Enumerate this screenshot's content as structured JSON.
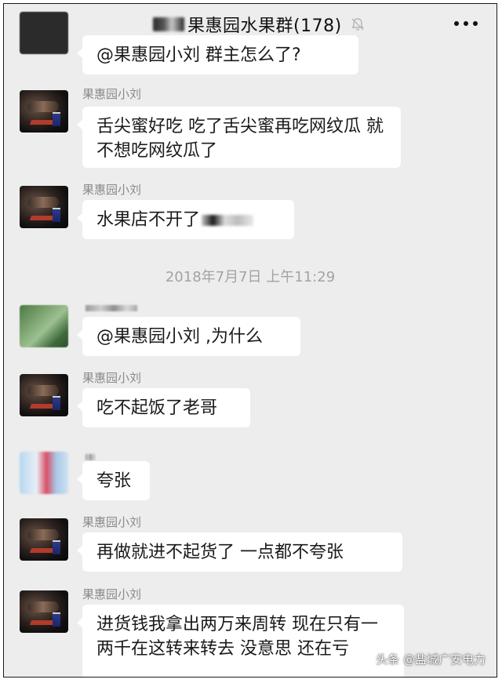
{
  "header": {
    "title": "果惠园水果群(178)",
    "back_icon": "chevron-left-icon",
    "mute_icon": "bell-muted-icon",
    "more_icon": "more-dots-icon"
  },
  "messages": [
    {
      "text": "@果惠园小刘 群主怎么了?"
    },
    {
      "sender": "果惠园小刘",
      "text": "舌尖蜜好吃 吃了舌尖蜜再吃网纹瓜 就不想吃网纹瓜了"
    },
    {
      "sender": "果惠园小刘",
      "text": "水果店不开了"
    },
    {
      "text": "@果惠园小刘 ,为什么"
    },
    {
      "sender": "果惠园小刘",
      "text": "吃不起饭了老哥"
    },
    {
      "text": "夸张"
    },
    {
      "sender": "果惠园小刘",
      "text": "再做就进不起货了 一点都不夸张"
    },
    {
      "sender": "果惠园小刘",
      "text": "进货钱我拿出两万来周转 现在只有一两千在这转来转去 没意思 还在亏"
    }
  ],
  "timestamp": "2018年7月7日 上午11:29",
  "watermark": "头条 @盐城广安电力",
  "colors": {
    "background": "#ededed",
    "bubble": "#ffffff",
    "sender_name": "#8a8a8a",
    "timestamp": "#a3a3a3"
  }
}
